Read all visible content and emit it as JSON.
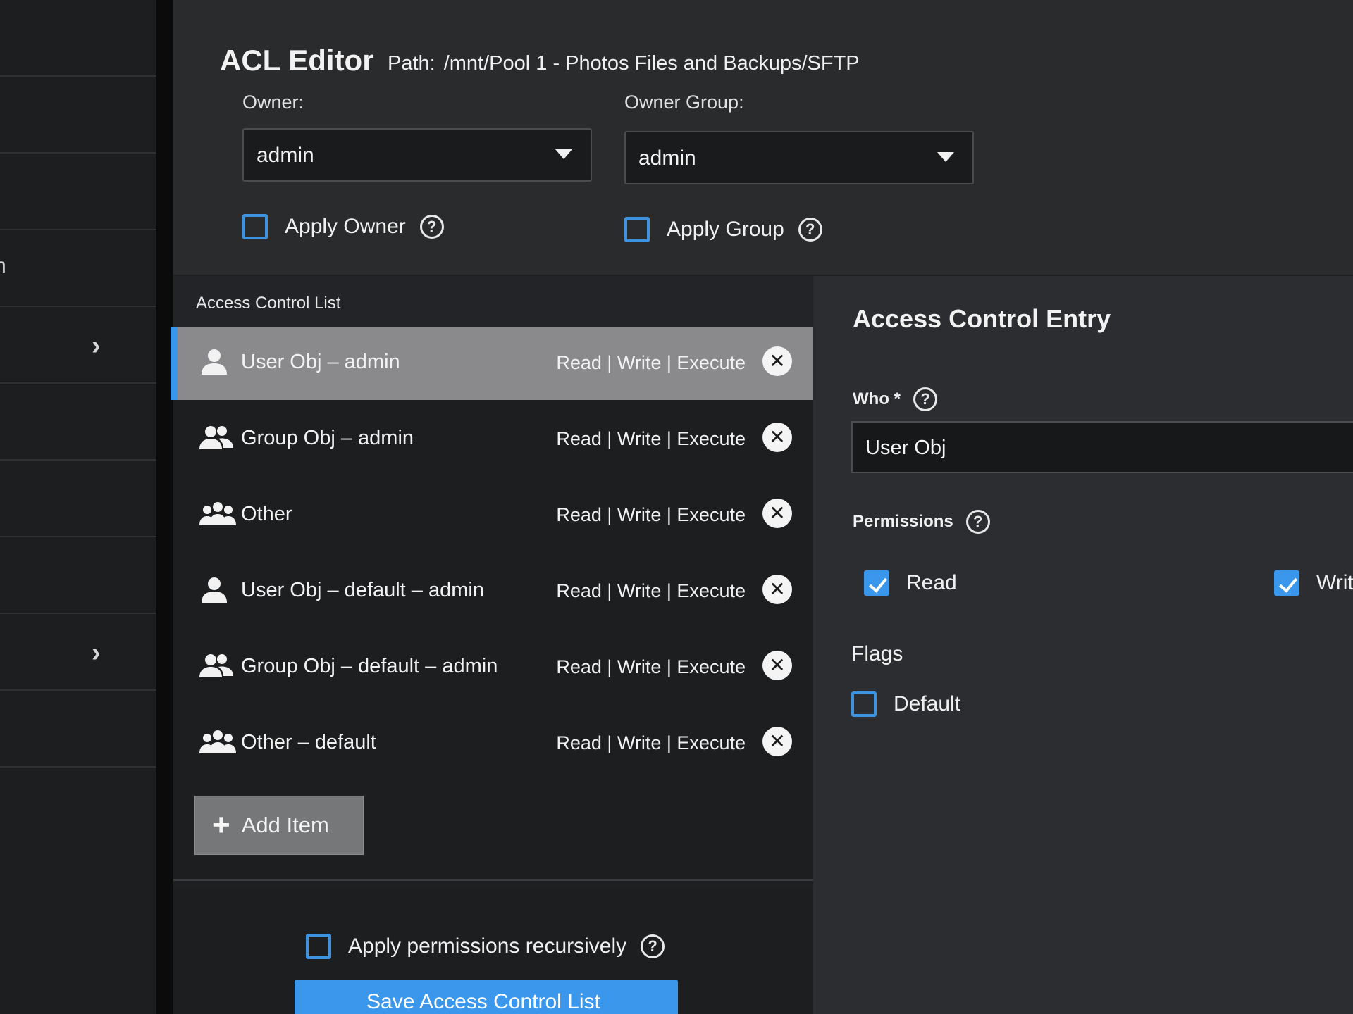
{
  "sidebar": {
    "label_fragment": "n",
    "chevron": "›"
  },
  "header": {
    "title": "ACL Editor",
    "path_label": "Path:",
    "path_value": "/mnt/Pool 1 - Photos Files and Backups/SFTP"
  },
  "owner": {
    "label": "Owner:",
    "value": "admin",
    "apply_label": "Apply Owner",
    "apply_checked": false
  },
  "owner_group": {
    "label": "Owner Group:",
    "value": "admin",
    "apply_label": "Apply Group",
    "apply_checked": false
  },
  "acl": {
    "header": "Access Control List",
    "items": [
      {
        "name": "User Obj – admin",
        "permissions": "Read | Write | Execute",
        "icon": "user-icon",
        "selected": true
      },
      {
        "name": "Group Obj – admin",
        "permissions": "Read | Write | Execute",
        "icon": "group-icon",
        "selected": false
      },
      {
        "name": "Other",
        "permissions": "Read | Write | Execute",
        "icon": "everyone-icon",
        "selected": false
      },
      {
        "name": "User Obj – default – admin",
        "permissions": "Read | Write | Execute",
        "icon": "user-icon",
        "selected": false
      },
      {
        "name": "Group Obj – default – admin",
        "permissions": "Read | Write | Execute",
        "icon": "group-icon",
        "selected": false
      },
      {
        "name": "Other – default",
        "permissions": "Read | Write | Execute",
        "icon": "everyone-icon",
        "selected": false
      }
    ],
    "add_item_label": "Add Item"
  },
  "footer": {
    "recursive_label": "Apply permissions recursively",
    "recursive_checked": false,
    "save_label": "Save Access Control List"
  },
  "ace": {
    "title": "Access Control Entry",
    "who_label": "Who *",
    "who_value": "User Obj",
    "permissions_label": "Permissions",
    "perm_read_label": "Read",
    "perm_read_checked": true,
    "perm_write_label": "Write",
    "perm_write_checked": true,
    "flags_label": "Flags",
    "flag_default_label": "Default",
    "flag_default_checked": false
  },
  "colors": {
    "accent": "#3a97ec",
    "panel": "#2a2b2d",
    "selected_row": "#8a8a8c"
  }
}
